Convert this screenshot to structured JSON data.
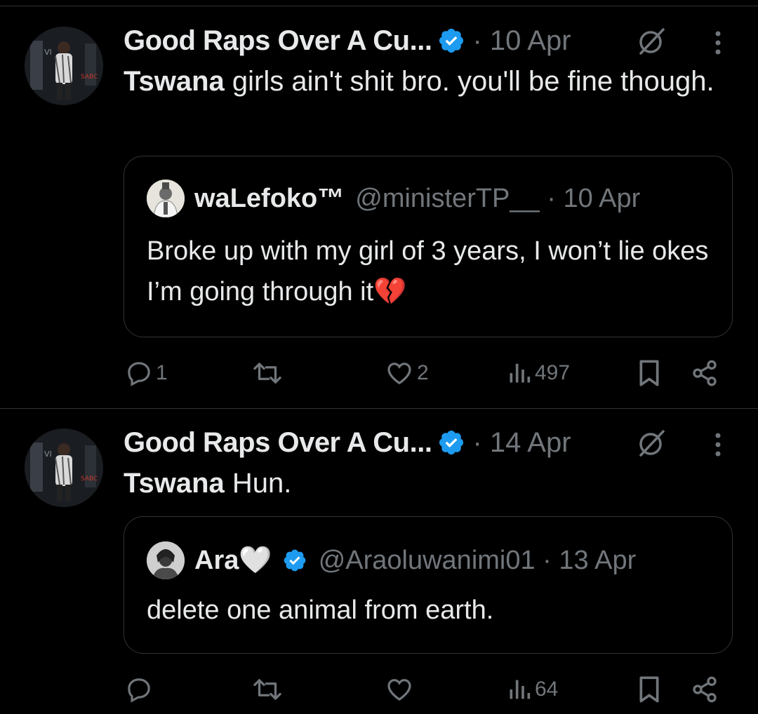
{
  "tweets": [
    {
      "author_name": "Good Raps Over A Cu...",
      "meta": "· 10 Apr",
      "text_bold": "Tswana",
      "text_rest": " girls ain't shit bro. you'll be fine though.",
      "quote": {
        "name": "waLefoko™",
        "handle": "@ministerTP__ · 10 Apr",
        "text": "Broke up with my girl of 3 years, I won’t lie okes I’m going through it💔"
      },
      "actions": {
        "replies": "1",
        "reposts": "",
        "likes": "2",
        "views": "497"
      }
    },
    {
      "author_name": "Good Raps Over A Cu...",
      "meta": "· 14 Apr",
      "text_bold": "Tswana",
      "text_rest": " Hun.",
      "quote": {
        "name": "Ara🤍",
        "handle": "@Araoluwanimi01 · 13 Apr",
        "text": "delete one animal from earth."
      },
      "actions": {
        "replies": "",
        "reposts": "",
        "likes": "",
        "views": "64"
      }
    }
  ],
  "icons": {
    "verified": "verified-badge-icon",
    "grok": "grok-icon",
    "more": "more-options-icon",
    "reply": "reply-icon",
    "repost": "repost-icon",
    "like": "like-icon",
    "views": "views-icon",
    "bookmark": "bookmark-icon",
    "share": "share-icon"
  },
  "colors": {
    "background": "#000000",
    "text": "#e7e9ea",
    "secondary": "#71767b",
    "border": "#2f3336",
    "verified": "#1d9bf0"
  }
}
